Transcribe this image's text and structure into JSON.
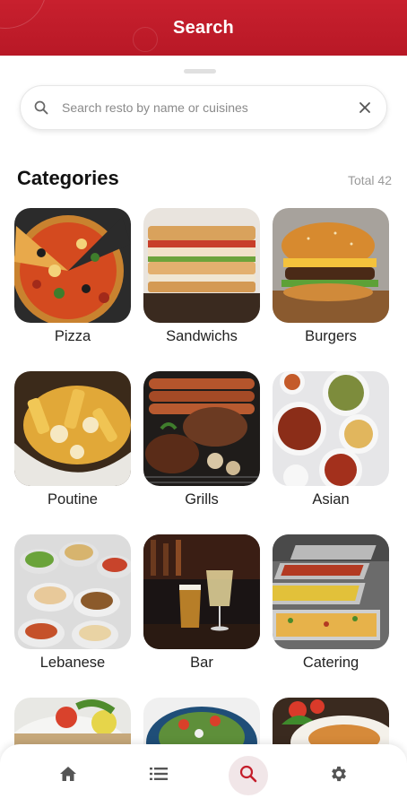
{
  "header": {
    "title": "Search"
  },
  "search": {
    "placeholder": "Search resto by name or cuisines",
    "value": ""
  },
  "categories": {
    "title": "Categories",
    "total_label": "Total 42",
    "items": [
      {
        "label": "Pizza"
      },
      {
        "label": "Sandwichs"
      },
      {
        "label": "Burgers"
      },
      {
        "label": "Poutine"
      },
      {
        "label": "Grills"
      },
      {
        "label": "Asian"
      },
      {
        "label": "Lebanese"
      },
      {
        "label": "Bar"
      },
      {
        "label": "Catering"
      },
      {
        "label": ""
      },
      {
        "label": ""
      },
      {
        "label": ""
      }
    ]
  },
  "nav": {
    "items": [
      {
        "icon": "home-icon",
        "active": false
      },
      {
        "icon": "list-icon",
        "active": false
      },
      {
        "icon": "search-icon",
        "active": true
      },
      {
        "icon": "gear-icon",
        "active": false
      }
    ]
  },
  "colors": {
    "brand": "#c41e2b",
    "active_nav_bg": "#f1e6e8",
    "icon_gray": "#555555"
  }
}
